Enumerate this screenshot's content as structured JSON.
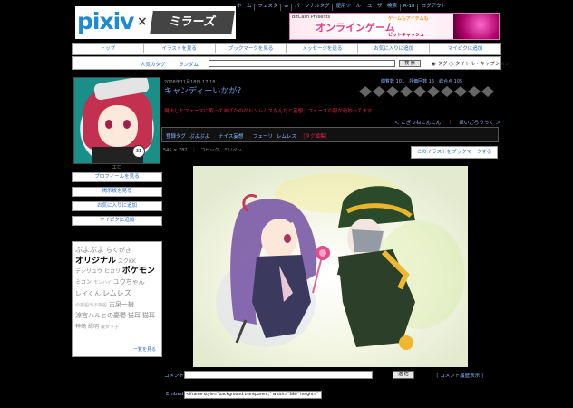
{
  "header": {
    "logo_text": "pixiv",
    "logo_cross": "×",
    "logo_mirrors": "ミラーズ",
    "nav": [
      "ホーム",
      "フェスタ",
      "ω",
      "パーソナルタグ",
      "便用ツール",
      "ユーザー検索",
      "R-18",
      "ログアウト"
    ]
  },
  "banner": {
    "line1": "BitCash Presents",
    "line2": "オンラインゲーム",
    "line3": "ゲームもアイテムも",
    "line4": "ビットキャッシュ"
  },
  "menu": [
    "トップ",
    "イラストを見る",
    "ブックマークを見る",
    "メッセージを送る",
    "お気に入りに追加",
    "マイピクに追加"
  ],
  "search": {
    "popular_tags": "人気のタグ",
    "random": "ランダム",
    "button": "検 索",
    "options": "◉ タグ ○ タイトル・キャプション"
  },
  "profile": {
    "username": "エロ",
    "avatar_badge": "31",
    "buttons": [
      "プロフィールを見る",
      "掲示板を見る",
      "お気に入りに追加",
      "マイピクに追加"
    ]
  },
  "tag_cloud": {
    "tags": [
      {
        "text": "ぷよぷよ",
        "size": 8,
        "color": "#888"
      },
      {
        "text": "らくがき",
        "size": 7,
        "color": "#888"
      },
      {
        "text": "オリジナル",
        "size": 9,
        "color": "#000"
      },
      {
        "text": "スクKK",
        "size": 6,
        "color": "#888"
      },
      {
        "text": "デシリュウ",
        "size": 6,
        "color": "#888"
      },
      {
        "text": "ヒカリ",
        "size": 6,
        "color": "#888"
      },
      {
        "text": "ポケモン",
        "size": 9,
        "color": "#000"
      },
      {
        "text": "ミカン",
        "size": 6,
        "color": "#888"
      },
      {
        "text": "モンハイ",
        "size": 5,
        "color": "#aaa"
      },
      {
        "text": "ユウちゃん",
        "size": 7,
        "color": "#888"
      },
      {
        "text": "レイくん",
        "size": 7,
        "color": "#888"
      },
      {
        "text": "レムレス",
        "size": 8,
        "color": "#888"
      },
      {
        "text": "ゆ夜船出る夜船",
        "size": 5,
        "color": "#aaa"
      },
      {
        "text": "古泉一樹",
        "size": 7,
        "color": "#888"
      },
      {
        "text": "涼宮ハルヒの憂鬱",
        "size": 7,
        "color": "#888"
      },
      {
        "text": "猫耳",
        "size": 7,
        "color": "#888"
      },
      {
        "text": "猫耳",
        "size": 7,
        "color": "#888"
      },
      {
        "text": "神崎",
        "size": 6,
        "color": "#888"
      },
      {
        "text": "緑明",
        "size": 6,
        "color": "#888"
      },
      {
        "text": "魔女ッ子",
        "size": 5,
        "color": "#aaa"
      }
    ],
    "more": "一覧を見る"
  },
  "work": {
    "date": "2008年11月18日 17:18",
    "title": "キャンディーいかが？",
    "rating_labels": "閲覧数 101　評価回数 15　総合点 105",
    "rating_count": 10,
    "caption": "現出したフェースに取ってあげたのがルシレムスなんだと妄想。フェースの服が奇妙ってます",
    "prev": "＜ こぎつねこんこん",
    "next": "ほいごろうっく ＞",
    "tags_label": "登録タグ",
    "tags": [
      "ぷよぷよ",
      "ナイス妄想",
      "フェーリ",
      "レムレス"
    ],
    "tags_edit": "［タグ編集］",
    "meta": "545 × 782　｜　コピック　ミリペン",
    "bookmark_button": "このイラストをブックマークする"
  },
  "comment": {
    "label": "コメント",
    "button": "送 信",
    "history": "［ コメント履歴表示 ］"
  },
  "embed": {
    "label": "Embed",
    "value": "<iframe style=\"background:transparent;\" width=\"380\" height=\""
  },
  "colors": {
    "background": "#000000",
    "link": "#2a6ac8",
    "title": "#6b9ae0",
    "caption": "#dd2244",
    "tag_edit": "#dd2244"
  }
}
